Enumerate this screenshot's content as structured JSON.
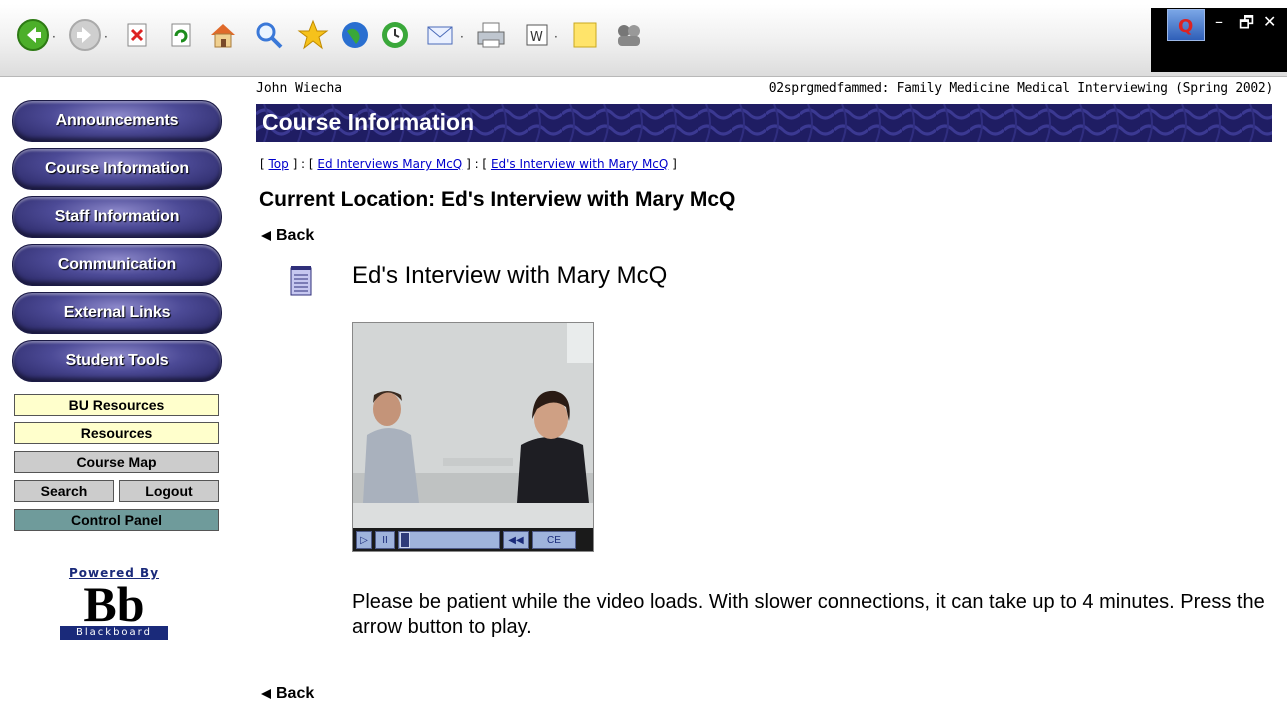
{
  "toolbar": {
    "drop_arrow": "·",
    "icons": [
      "back-icon",
      "forward-icon",
      "stop-icon",
      "refresh-icon",
      "home-icon",
      "search-icon",
      "favorites-icon",
      "media-icon",
      "history-icon",
      "mail-icon",
      "print-icon",
      "edit-icon",
      "discuss-icon",
      "messenger-icon"
    ],
    "win_min": "–",
    "win_restore": "🗗",
    "win_close": "✕"
  },
  "sidebar": {
    "buttons": [
      {
        "label": "Announcements"
      },
      {
        "label": "Course Information"
      },
      {
        "label": "Staff Information"
      },
      {
        "label": "Communication"
      },
      {
        "label": "External Links"
      },
      {
        "label": "Student Tools"
      }
    ],
    "boxes": {
      "bu_resources": "BU Resources",
      "resources": "Resources",
      "course_map": "Course Map",
      "search": "Search",
      "logout": "Logout",
      "control_panel": "Control Panel"
    },
    "box_colors": {
      "yellow": "#ffffcc",
      "gray": "#cccccc",
      "teal": "#6f9b9b"
    },
    "powered": {
      "powered_by": "Powered By",
      "letters": "Bb",
      "word": "Blackboard"
    }
  },
  "header": {
    "user": "John Wiecha",
    "course": "02sprgmedfammed: Family Medicine Medical Interviewing (Spring 2002)"
  },
  "banner": {
    "title": "Course Information",
    "color": "#1f1d63"
  },
  "breadcrumb": {
    "open": "[ ",
    "sep": " ] : [ ",
    "close": " ]",
    "top": "Top",
    "item1": "Ed Interviews Mary McQ",
    "item2": "Ed's Interview with Mary McQ"
  },
  "location": "Current Location: Ed's Interview with Mary McQ",
  "back_label": "Back",
  "item": {
    "title": "Ed's Interview with Mary McQ"
  },
  "video": {
    "controls": [
      "▷",
      "II",
      "◀◀",
      "CE"
    ]
  },
  "message": "Please be patient while the video loads. With slower connections, it can take up to 4 minutes. Press the arrow button to play."
}
